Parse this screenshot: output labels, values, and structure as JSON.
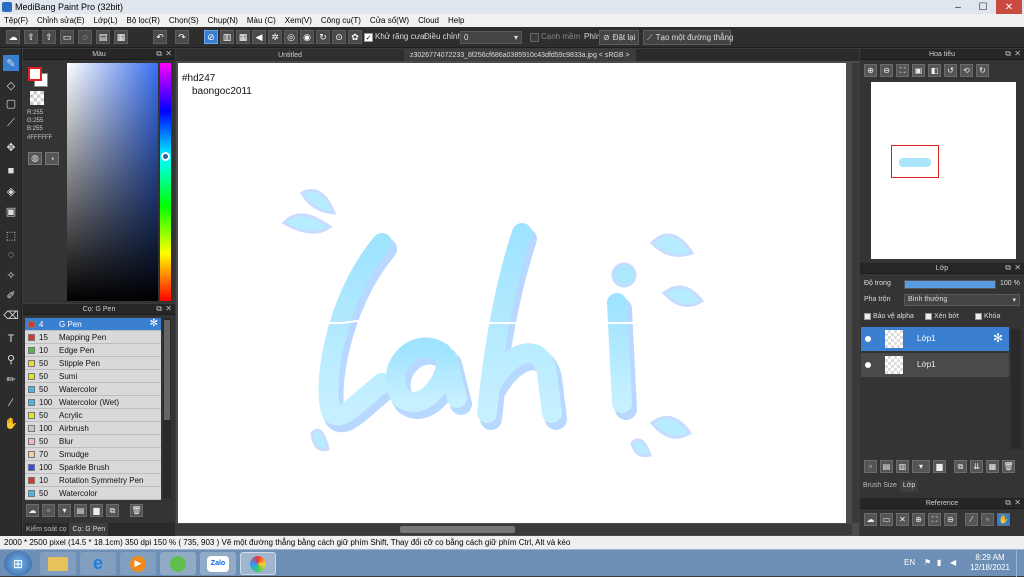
{
  "window": {
    "title": "MediBang Paint Pro (32bit)"
  },
  "menu": [
    "Tệp(F)",
    "Chỉnh sửa(E)",
    "Lớp(L)",
    "Bộ lọc(R)",
    "Chọn(S)",
    "Chụp(N)",
    "Màu (C)",
    "Xem(V)",
    "Công cụ(T)",
    "Cửa sổ(W)",
    "Cloud",
    "Help"
  ],
  "toolbar": {
    "antialias_label": "Khử răng cưa",
    "adjust_label": "Điều chỉnh",
    "adjust_value": "0",
    "edge_label": "Cạnh mềm",
    "key_label": "Phím",
    "reset_label": "Đặt lại",
    "ruler_label": "Tạo một đường thẳng"
  },
  "color_panel": {
    "title": "Màu",
    "r": "R:255",
    "g": "G:255",
    "b": "B:255",
    "hex": "#FFFFFF",
    "primary_color": "#e02020",
    "secondary_color": "#ffffff"
  },
  "brush_panel": {
    "title": "Cọ: G Pen",
    "items": [
      {
        "size": "4",
        "name": "G Pen",
        "color": "#e03030"
      },
      {
        "size": "15",
        "name": "Mapping Pen",
        "color": "#e03030"
      },
      {
        "size": "10",
        "name": "Edge Pen",
        "color": "#44c040"
      },
      {
        "size": "50",
        "name": "Stipple Pen",
        "color": "#e8e020"
      },
      {
        "size": "50",
        "name": "Sumi",
        "color": "#e8e020"
      },
      {
        "size": "50",
        "name": "Watercolor",
        "color": "#40b8e8"
      },
      {
        "size": "100",
        "name": "Watercolor (Wet)",
        "color": "#40b8e8"
      },
      {
        "size": "50",
        "name": "Acrylic",
        "color": "#e8e020"
      },
      {
        "size": "100",
        "name": "Airbrush",
        "color": "#c8c8c8"
      },
      {
        "size": "50",
        "name": "Blur",
        "color": "#f0b0e0"
      },
      {
        "size": "70",
        "name": "Smudge",
        "color": "#f0d0a0"
      },
      {
        "size": "100",
        "name": "Sparkle Brush",
        "color": "#3050e0"
      },
      {
        "size": "10",
        "name": "Rotation Symmetry Pen",
        "color": "#e03030"
      },
      {
        "size": "50",
        "name": "Watercolor",
        "color": "#40b8e8"
      }
    ],
    "bottom_tabs": [
      "Kiểm soát cọ",
      "Cọ: G Pen"
    ]
  },
  "canvas_tabs": [
    "Untitled",
    "z3026774072233_8f256cf686a0385910c43dfd59c9833a.jpg < sRGB >"
  ],
  "canvas_text": {
    "line1": "#hd247",
    "line2": "baongoc2011",
    "art": "lahi"
  },
  "navigator": {
    "title": "Hoa tiêu"
  },
  "layer_panel": {
    "title": "Lớp",
    "opacity_label": "Độ trong",
    "opacity_value": "100 %",
    "opacity_fraction": 1.0,
    "blend_label": "Pha trộn",
    "blend_value": "Bình thường",
    "protect_alpha": "Bảo vệ alpha",
    "clip": "Xén bớt",
    "lock": "Khóa",
    "layers": [
      "Lớp1",
      "Lớp1"
    ],
    "tabs": [
      "Brush Size",
      "Lớp"
    ]
  },
  "reference_panel": {
    "title": "Reference"
  },
  "status": {
    "text": "2000 * 2500 pixel   (14.5 * 18.1cm)   350 dpi   150 %   ( 735, 903 )  Vẽ một đường thẳng bằng cách giữ phím Shift, Thay đổi cỡ cọ bằng cách giữ phím Ctrl, Alt và kéo"
  },
  "taskbar": {
    "lang": "EN",
    "time": "8:29 AM",
    "date": "12/18/2021",
    "zalo": "Zalo"
  }
}
